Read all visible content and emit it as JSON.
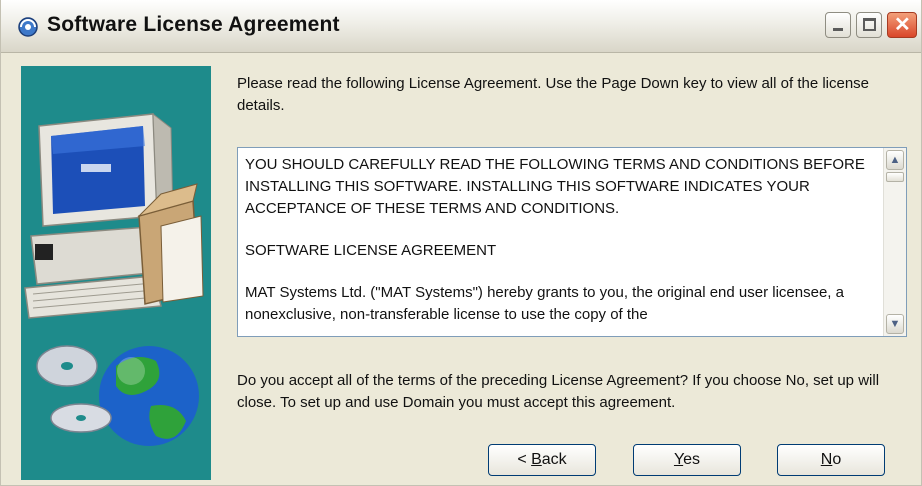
{
  "window": {
    "title": "Software License Agreement",
    "controls": {
      "minimize_icon": "minimize-icon",
      "maximize_icon": "maximize-icon",
      "close_icon": "close-icon"
    }
  },
  "sidebar": {
    "background": "#1e8b8b",
    "illustration": "computer-with-box-globe-and-cds"
  },
  "intro": {
    "text": "Please read the following License Agreement. Use the Page Down key to view all of the license details."
  },
  "license": {
    "paragraphs": [
      "YOU SHOULD CAREFULLY READ THE FOLLOWING TERMS AND CONDITIONS BEFORE INSTALLING THIS SOFTWARE. INSTALLING THIS SOFTWARE INDICATES YOUR ACCEPTANCE OF THESE TERMS AND CONDITIONS.",
      "SOFTWARE LICENSE AGREEMENT",
      "MAT Systems Ltd. (\"MAT Systems\") hereby grants to you, the original end user licensee, a nonexclusive, non-transferable license to use the copy of the"
    ]
  },
  "question": {
    "text": "Do you accept all of the terms of the preceding License Agreement? If you choose No, set up will close. To set up and use Domain you must accept this agreement."
  },
  "buttons": {
    "back": {
      "prefix": "< ",
      "mnemonic": "B",
      "rest": "ack"
    },
    "yes": {
      "mnemonic": "Y",
      "rest": "es"
    },
    "no": {
      "mnemonic": "N",
      "rest": "o"
    }
  }
}
